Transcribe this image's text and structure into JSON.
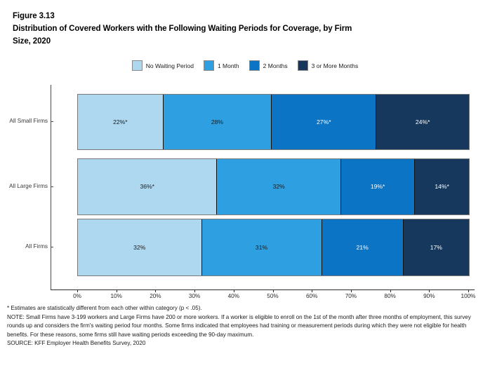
{
  "title": {
    "line1": "Figure 3.13",
    "line2": "Distribution of Covered Workers with the Following Waiting Periods for Coverage, by Firm",
    "line3": "Size, 2020"
  },
  "footnotes": {
    "asterisk": "* Estimates are statistically different from each other within category (p < .05).",
    "note": "NOTE: Small Firms have 3-199 workers and Large Firms have 200 or more workers. If a worker is eligible to enroll on the 1st of the month after three months of employment, this survey rounds up and considers the firm's waiting period four months. Some firms indicated that employees had training or measurement periods during which they were not eligible for health benefits. For these reasons, some firms still have waiting periods exceeding the 90-day maximum.",
    "source": "SOURCE: KFF Employer Health Benefits Survey, 2020"
  },
  "chart_data": {
    "type": "bar",
    "orientation": "horizontal",
    "stacked": true,
    "stack_mode": "percent",
    "title": "Distribution of Covered Workers with the Following Waiting Periods for Coverage, by Firm Size, 2020",
    "xlabel": "",
    "ylabel": "",
    "xlim": [
      0,
      100
    ],
    "xticks": [
      0,
      10,
      20,
      30,
      40,
      50,
      60,
      70,
      80,
      90,
      100
    ],
    "xtick_labels": [
      "0%",
      "10%",
      "20%",
      "30%",
      "40%",
      "50%",
      "60%",
      "70%",
      "80%",
      "90%",
      "100%"
    ],
    "grid": false,
    "legend_position": "top-center",
    "categories": [
      "All Small Firms",
      "All Large Firms",
      "All Firms"
    ],
    "series": [
      {
        "name": "No Waiting Period",
        "color": "#ADD8F0",
        "values": [
          22,
          36,
          32
        ],
        "labels": [
          "22%*",
          "36%*",
          "32%"
        ],
        "label_color": "dark"
      },
      {
        "name": "1 Month",
        "color": "#2E9FE0",
        "values": [
          28,
          32,
          31
        ],
        "labels": [
          "28%",
          "32%",
          "31%"
        ],
        "label_color": "dark"
      },
      {
        "name": "2 Months",
        "color": "#0B74C4",
        "values": [
          27,
          19,
          21
        ],
        "labels": [
          "27%*",
          "19%*",
          "21%"
        ],
        "label_color": "light"
      },
      {
        "name": "3 or More Months",
        "color": "#16385C",
        "values": [
          24,
          14,
          17
        ],
        "labels": [
          "24%*",
          "14%*",
          "17%"
        ],
        "label_color": "light"
      }
    ]
  }
}
